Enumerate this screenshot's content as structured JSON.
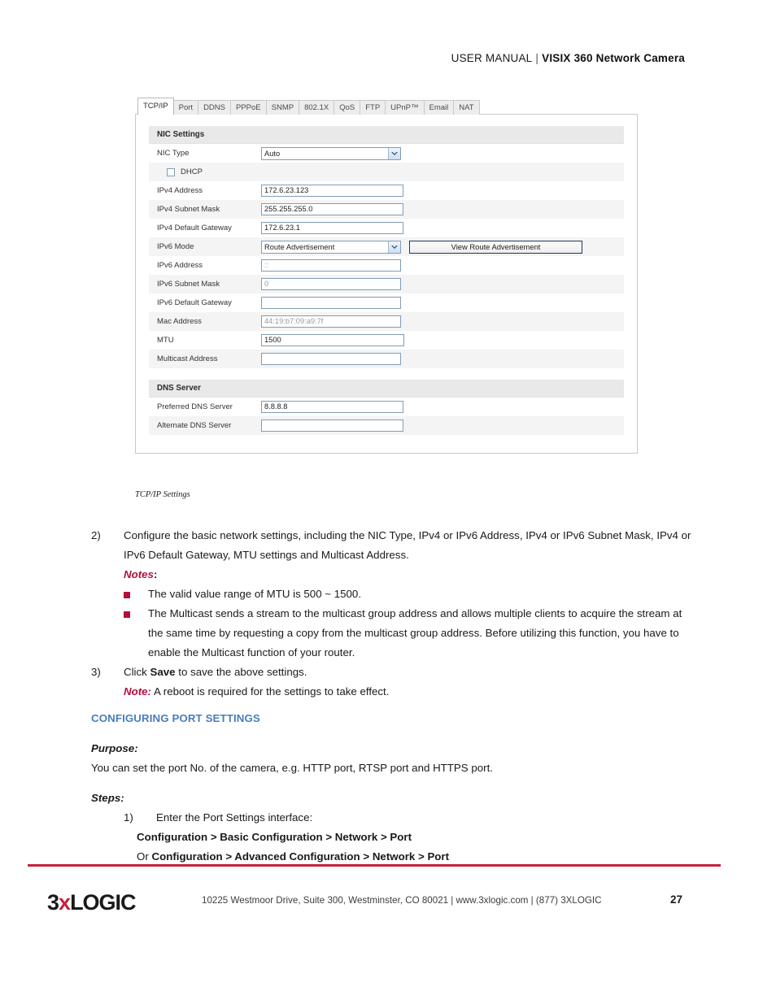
{
  "header": {
    "label": "USER MANUAL",
    "separator": "|",
    "product": "VISIX 360 Network Camera"
  },
  "figure": {
    "caption": "TCP/IP Settings",
    "tabs": [
      {
        "label": "TCP/IP",
        "active": true
      },
      {
        "label": "Port",
        "active": false
      },
      {
        "label": "DDNS",
        "active": false
      },
      {
        "label": "PPPoE",
        "active": false
      },
      {
        "label": "SNMP",
        "active": false
      },
      {
        "label": "802.1X",
        "active": false
      },
      {
        "label": "QoS",
        "active": false
      },
      {
        "label": "FTP",
        "active": false
      },
      {
        "label": "UPnP™",
        "active": false
      },
      {
        "label": "Email",
        "active": false
      },
      {
        "label": "NAT",
        "active": false
      }
    ],
    "nic_section_title": "NIC Settings",
    "dns_section_title": "DNS Server",
    "nic_type": {
      "label": "NIC Type",
      "value": "Auto"
    },
    "dhcp": {
      "label": "DHCP",
      "checked": false
    },
    "ipv4_address": {
      "label": "IPv4 Address",
      "value": "172.6.23.123"
    },
    "ipv4_subnet_mask": {
      "label": "IPv4 Subnet Mask",
      "value": "255.255.255.0"
    },
    "ipv4_default_gateway": {
      "label": "IPv4 Default Gateway",
      "value": "172.6.23.1"
    },
    "ipv6_mode": {
      "label": "IPv6 Mode",
      "value": "Route Advertisement"
    },
    "view_route_button": "View Route Advertisement",
    "ipv6_address": {
      "label": "IPv6 Address",
      "value": "::"
    },
    "ipv6_subnet_mask": {
      "label": "IPv6 Subnet Mask",
      "value": "0"
    },
    "ipv6_default_gateway": {
      "label": "IPv6 Default Gateway",
      "value": ""
    },
    "mac_address": {
      "label": "Mac Address",
      "value": "44:19:b7:09:a9:7f"
    },
    "mtu": {
      "label": "MTU",
      "value": "1500"
    },
    "multicast_address": {
      "label": "Multicast Address",
      "value": ""
    },
    "preferred_dns": {
      "label": "Preferred DNS Server",
      "value": "8.8.8.8"
    },
    "alternate_dns": {
      "label": "Alternate DNS Server",
      "value": ""
    }
  },
  "body": {
    "step2": {
      "num": "2)",
      "text": "Configure the basic network settings, including the NIC Type, IPv4 or IPv6 Address, IPv4 or IPv6 Subnet Mask, IPv4 or IPv6 Default Gateway, MTU settings and Multicast Address."
    },
    "notes_label": "Notes",
    "notes_colon": ":",
    "bullets": [
      "The valid value range of MTU is 500 ~ 1500.",
      "The Multicast sends a stream to the multicast group address and allows multiple clients to acquire the stream at the same time by requesting a copy from the multicast group address. Before utilizing this function, you have to enable the Multicast function of your router."
    ],
    "step3": {
      "num": "3)",
      "pre": "Click ",
      "bold": "Save",
      "post": " to save the above settings."
    },
    "note": {
      "label": "Note:",
      "text": " A reboot is required for the settings to take effect."
    },
    "section_heading": "CONFIGURING PORT SETTINGS",
    "purpose_label": "Purpose:",
    "purpose_text": "You can set the port No. of the camera, e.g. HTTP port, RTSP port and HTTPS port.",
    "steps_label": "Steps:",
    "step1": {
      "num": "1)",
      "text": "Enter the Port Settings interface:"
    },
    "path1": "Configuration > Basic Configuration > Network > Port",
    "path2_pre": "Or ",
    "path2": "Configuration > Advanced Configuration > Network > Port"
  },
  "footer": {
    "logo_part1": "3",
    "logo_x": "x",
    "logo_part2": "LOGIC",
    "address": "10225 Westmoor Drive, Suite 300, Westminster, CO 80021 | www.3xlogic.com | (877) 3XLOGIC",
    "page_number": "27"
  },
  "colors": {
    "accent_red": "#b2103a",
    "rule_red": "#c8203f",
    "heading_blue": "#4a7ebb"
  }
}
